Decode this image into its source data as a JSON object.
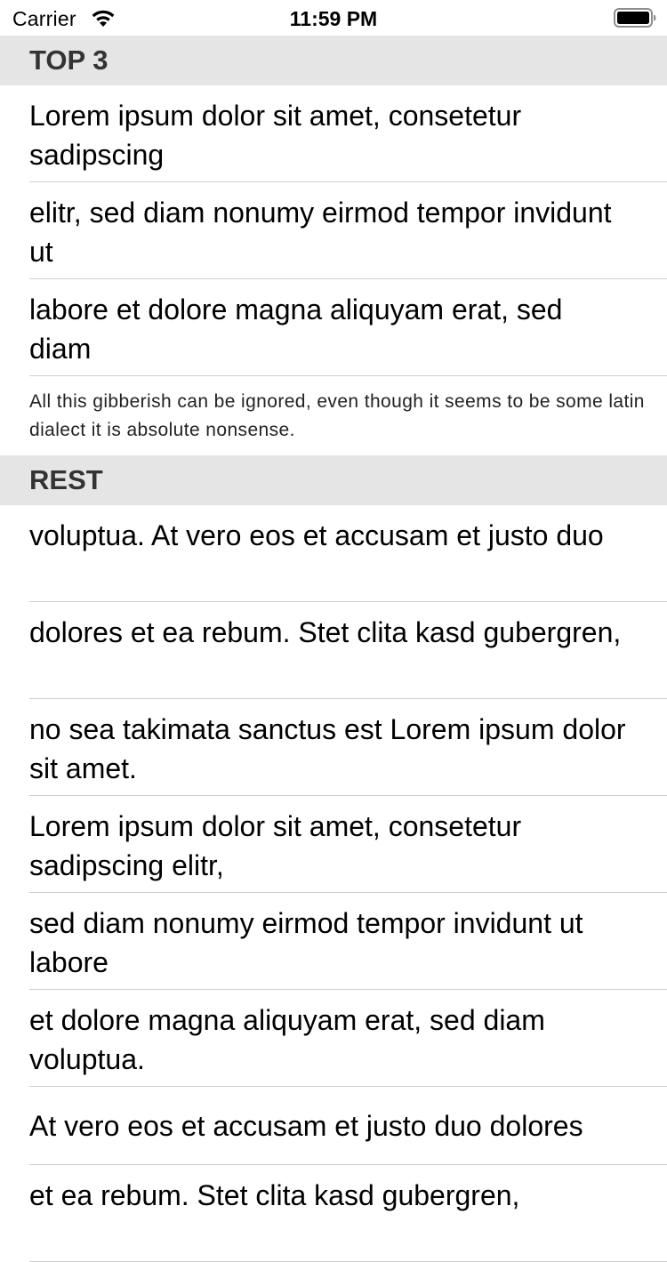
{
  "status_bar": {
    "carrier": "Carrier",
    "time": "11:59 PM"
  },
  "sections": [
    {
      "header": "TOP 3",
      "rows": [
        "Lorem ipsum dolor sit amet, consetetur sadipscing",
        "elitr, sed diam nonumy eirmod tempor invidunt ut",
        "labore et dolore magna aliquyam erat, sed diam"
      ],
      "footer": "All this gibberish can be ignored, even though it seems to be some latin dialect it is absolute nonsense."
    },
    {
      "header": "REST",
      "rows": [
        "voluptua. At vero eos et accusam et justo duo",
        "dolores et ea rebum. Stet clita kasd gubergren,",
        "no sea takimata sanctus est Lorem ipsum dolor sit amet.",
        "Lorem ipsum dolor sit amet, consetetur sadipscing elitr,",
        "sed diam nonumy eirmod tempor invidunt ut labore",
        "et dolore magna aliquyam erat, sed diam voluptua.",
        "At vero eos et accusam et justo duo dolores",
        "et ea rebum. Stet clita kasd gubergren,"
      ]
    }
  ],
  "colors": {
    "header_background": "#e5e5e5",
    "separator": "#cfcfcf"
  }
}
